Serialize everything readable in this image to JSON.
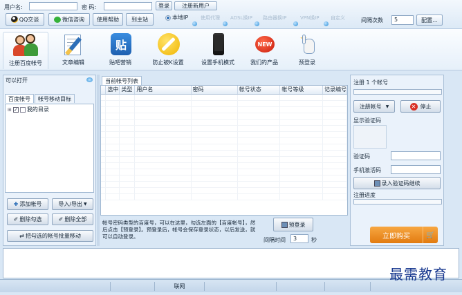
{
  "top": {
    "username_label": "用户名:",
    "password_label": "密  码:",
    "login_button": "登录",
    "register_button": "注册新用户",
    "qq_button": "QQ交谈",
    "wechat_button": "微信咨询",
    "help_button": "使用帮助",
    "home_button": "到主站",
    "ip_local": "本地IP",
    "ip_options": [
      "使用代理",
      "ADSL换IP",
      "路由器换IP",
      "VPN换IP",
      "自定义"
    ],
    "interval_label": "间隔次数",
    "interval_value": "5",
    "config_button": "配置..."
  },
  "toolbar": [
    {
      "label": "注册百度帐号",
      "icon": "people-icon"
    },
    {
      "label": "文章编辑",
      "icon": "edit-icon"
    },
    {
      "label": "贴吧营销",
      "icon": "tieba-icon"
    },
    {
      "label": "防止被K设置",
      "icon": "wrench-icon"
    },
    {
      "label": "设置手机模式",
      "icon": "phone-icon"
    },
    {
      "label": "我们的产品",
      "icon": "new-badge-icon"
    },
    {
      "label": "预登录",
      "icon": "hand-click-icon"
    }
  ],
  "left": {
    "title": "可以打开",
    "tabs": [
      "百度帐号",
      "帐号移动目标"
    ],
    "tree_root": "我的目录",
    "buttons": [
      "添加帐号",
      "导入/导出",
      "删除勾选",
      "删除全部",
      "把勾选的帐号批量移动"
    ]
  },
  "center": {
    "tab": "当前帐号列表",
    "columns": [
      "选中",
      "类型",
      "用户名",
      "密码",
      "帐号状态",
      "帐号等级",
      "记录编号"
    ],
    "info_text": "帐号密码类型的百度号，可以在这里，勾选左面的【百度帐号】，然后点击【预登录】。预登录后，帐号会保存登录状态，以后发送，就可以自动登录。",
    "prelogin_button": "预登录",
    "interval_label": "间隔时间",
    "interval_value": "3",
    "seconds": "秒"
  },
  "right": {
    "title": "注册 1 个帐号",
    "register_button": "注册帐号",
    "stop_button": "停止",
    "captcha_display_label": "显示验证码",
    "captcha_label": "验证码",
    "sms_label": "手机激活码",
    "confirm_button": "录入验证码继续",
    "progress_label": "注册进度",
    "buy_button": "立即购买"
  },
  "status": {
    "network": "联网"
  },
  "watermark": "最需教育",
  "colors": {
    "accent": "#2d6fb8",
    "buy": "#ef8a1f",
    "stop": "#d93025"
  }
}
